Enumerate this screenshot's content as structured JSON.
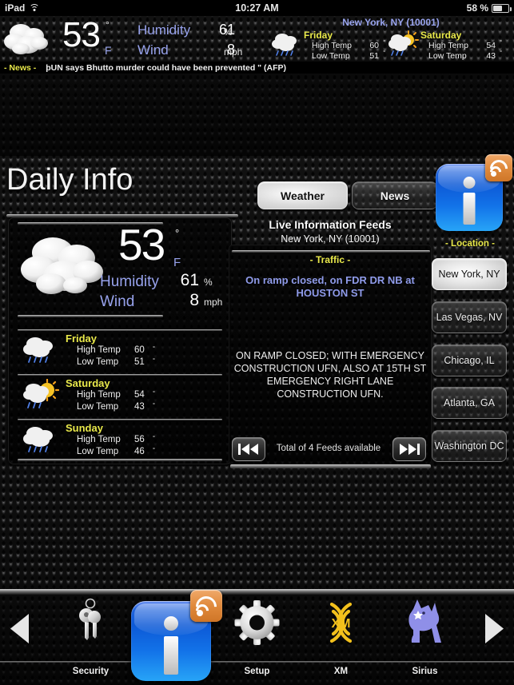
{
  "statusbar": {
    "device": "iPad",
    "wifi_icon": "wifi-icon",
    "time": "10:27 AM",
    "battery_percent": "58 %",
    "battery_icon": "battery-icon"
  },
  "top_banner": {
    "condition_icon": "cloudy-icon",
    "temperature": "53",
    "degree_symbol": "°",
    "unit": "F",
    "humidity_label": "Humidity",
    "humidity_value": "61",
    "humidity_unit": "%",
    "wind_label": "Wind",
    "wind_value": "8",
    "wind_unit": "mph",
    "location": "New York, NY (10001)",
    "forecast": [
      {
        "day": "Friday",
        "icon": "rain-cloud-icon",
        "high_label": "High Temp",
        "high_value": "60",
        "high_deg": "°",
        "low_label": "Low Temp",
        "low_value": "51",
        "low_deg": "°"
      },
      {
        "day": "Saturday",
        "icon": "sun-rain-cloud-icon",
        "high_label": "High Temp",
        "high_value": "54",
        "high_deg": "°",
        "low_label": "Low Temp",
        "low_value": "43",
        "low_deg": "°"
      }
    ]
  },
  "ticker": {
    "tag": "- News -",
    "headline": "þUN says Bhutto murder could have been prevented \" (AFP)"
  },
  "header": {
    "title": "Daily Info",
    "tabs": [
      {
        "label": "Weather",
        "selected": true
      },
      {
        "label": "News",
        "selected": false
      }
    ]
  },
  "weather_panel": {
    "condition_icon": "cloudy-icon",
    "temperature": "53",
    "degree_symbol": "°",
    "unit": "F",
    "humidity_label": "Humidity",
    "humidity_value": "61",
    "humidity_unit": "%",
    "wind_label": "Wind",
    "wind_value": "8",
    "wind_unit": "mph",
    "forecast": [
      {
        "day": "Friday",
        "icon": "rain-cloud-icon",
        "high_label": "High Temp",
        "high_value": "60",
        "high_deg": "°",
        "low_label": "Low Temp",
        "low_value": "51",
        "low_deg": "°"
      },
      {
        "day": "Saturday",
        "icon": "sun-rain-cloud-icon",
        "high_label": "High Temp",
        "high_value": "54",
        "high_deg": "°",
        "low_label": "Low Temp",
        "low_value": "43",
        "low_deg": "°"
      },
      {
        "day": "Sunday",
        "icon": "rain-cloud-icon",
        "high_label": "High Temp",
        "high_value": "56",
        "high_deg": "°",
        "low_label": "Low Temp",
        "low_value": "46",
        "low_deg": "°"
      }
    ]
  },
  "feeds": {
    "title": "Live Information Feeds",
    "location": "New York, NY (10001)",
    "category": "- Traffic -",
    "headline": "On ramp closed, on FDR DR NB at HOUSTON ST",
    "body": "ON RAMP CLOSED; WITH EMERGENCY CONSTRUCTION UFN, ALSO AT 15TH ST EMERGENCY RIGHT LANE CONSTRUCTION UFN.",
    "prev_icon": "skip-previous-icon",
    "next_icon": "skip-next-icon",
    "count_text": "Total of 4 Feeds available"
  },
  "sidebar": {
    "app_icon": "info-app-icon",
    "rss_badge_icon": "rss-icon",
    "location_label": "- Location -",
    "locations": [
      {
        "label": "New York, NY",
        "selected": true
      },
      {
        "label": "Las Vegas, NV",
        "selected": false
      },
      {
        "label": "Chicago, IL",
        "selected": false
      },
      {
        "label": "Atlanta, GA",
        "selected": false
      },
      {
        "label": "Washington DC",
        "selected": false
      }
    ]
  },
  "dock": {
    "prev_icon": "arrow-left-icon",
    "next_icon": "arrow-right-icon",
    "items": [
      {
        "label": "Security",
        "icon": "keys-icon"
      },
      {
        "label": "",
        "icon": "info-app-icon"
      },
      {
        "label": "Setup",
        "icon": "gear-icon"
      },
      {
        "label": "XM",
        "icon": "xm-radio-icon"
      },
      {
        "label": "Sirius",
        "icon": "sirius-dog-icon"
      }
    ]
  },
  "colors": {
    "accent_blue": "#97a2ec",
    "accent_yellow": "#e8e84a",
    "text_white": "#f2f2f2",
    "app_blue": "#1272e8",
    "rss_orange": "#e08a3c",
    "xm_yellow": "#f2c01c",
    "sirius_purple": "#8f8fe8"
  }
}
